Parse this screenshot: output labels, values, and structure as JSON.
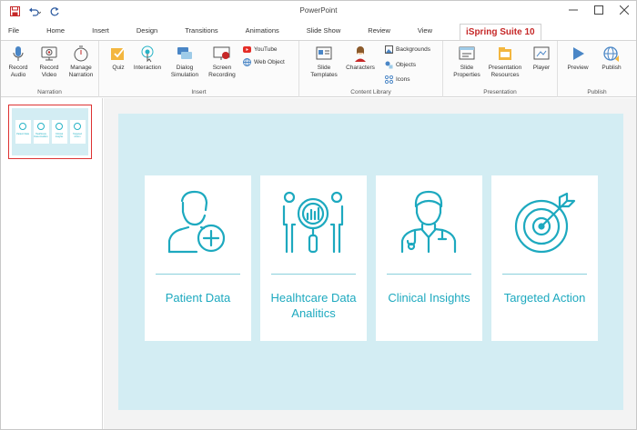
{
  "window": {
    "title": "PowerPoint"
  },
  "tabs": [
    {
      "label": "File"
    },
    {
      "label": "Home"
    },
    {
      "label": "Insert"
    },
    {
      "label": "Design"
    },
    {
      "label": "Transitions"
    },
    {
      "label": "Animations"
    },
    {
      "label": "Slide Show"
    },
    {
      "label": "Review"
    },
    {
      "label": "View"
    },
    {
      "label": "iSpring Suite 10"
    }
  ],
  "ribbon": {
    "narration": {
      "label": "Narration",
      "record_audio": "Record Audio",
      "record_video": "Record Video",
      "manage_narration": "Manage Narration"
    },
    "insert": {
      "label": "Insert",
      "quiz": "Quiz",
      "interaction": "Interaction",
      "dialog_simulation": "Dialog Simulation",
      "screen_recording": "Screen Recording",
      "youtube": "YouTube",
      "web_object": "Web Object"
    },
    "content_library": {
      "label": "Content Library",
      "slide_templates": "Slide Templates",
      "characters": "Characters",
      "backgrounds": "Backgrounds",
      "objects": "Objects",
      "icons": "Icons"
    },
    "presentation": {
      "label": "Presentation",
      "slide_properties": "Slide Properties",
      "presentation_resources": "Presentation Resources",
      "player": "Player"
    },
    "publish": {
      "label": "Publish",
      "preview": "Preview",
      "publish": "Publish"
    }
  },
  "slide": {
    "cards": [
      {
        "title": "Patient Data",
        "icon": "patient-add-icon"
      },
      {
        "title": "Healhtcare Data Analitics",
        "icon": "data-analytics-icon"
      },
      {
        "title": "Clinical Insights",
        "icon": "doctor-icon"
      },
      {
        "title": "Targeted Action",
        "icon": "target-icon"
      }
    ],
    "thumb_cards": [
      "Patient Data",
      "Healhtcare Data Analitics",
      "Clinical Insights",
      "Targeted Action"
    ]
  },
  "colors": {
    "accent": "#1da9bf",
    "slide_bg": "#d3edf3",
    "brand_tab": "#c62828"
  }
}
